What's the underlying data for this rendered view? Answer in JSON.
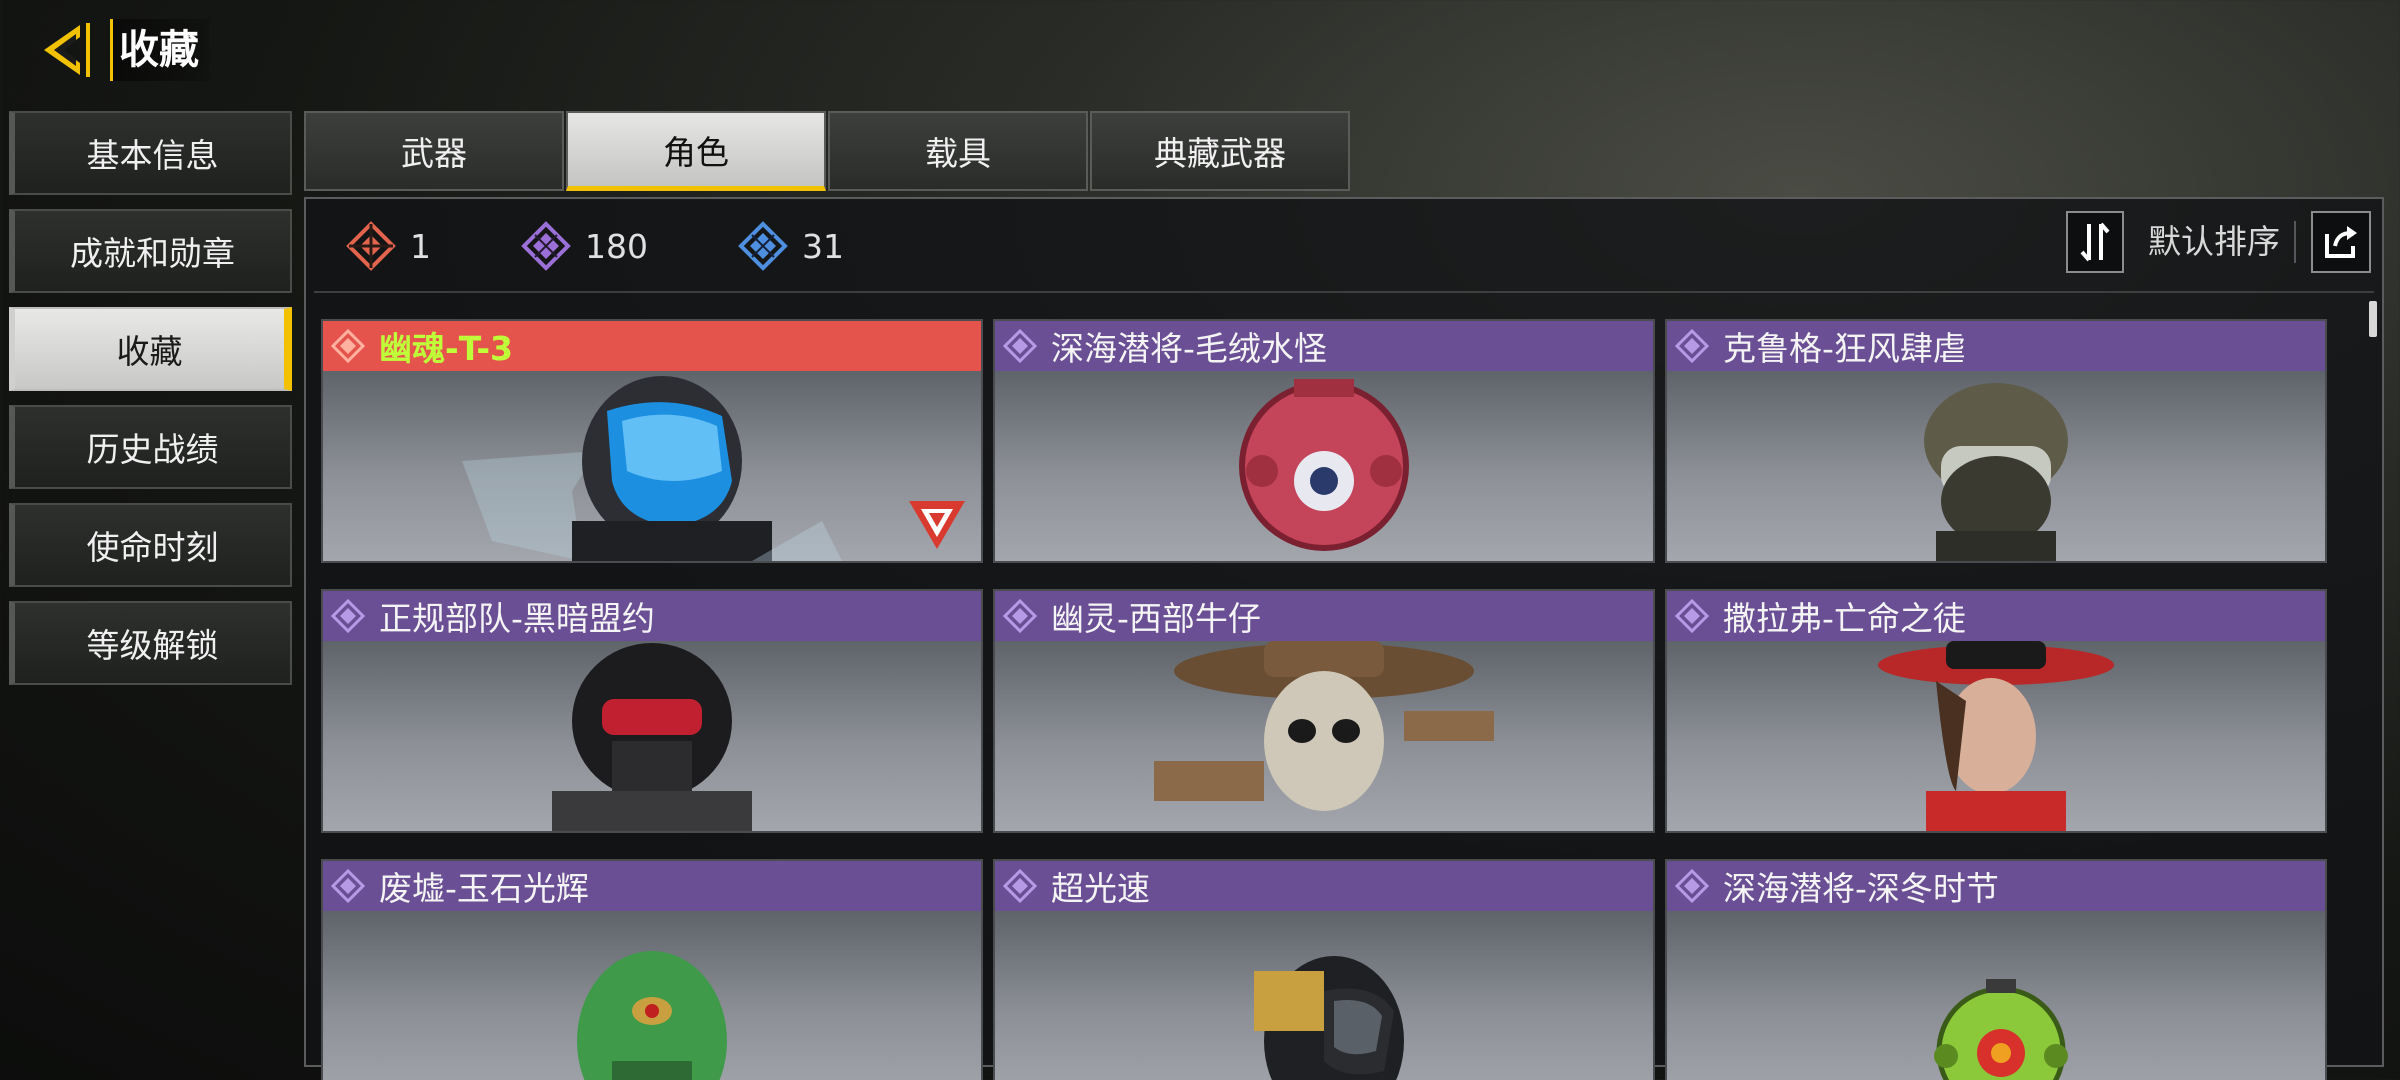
{
  "header": {
    "title": "收藏"
  },
  "sidebar": {
    "items": [
      {
        "label": "基本信息"
      },
      {
        "label": "成就和勋章"
      },
      {
        "label": "收藏"
      },
      {
        "label": "历史战绩"
      },
      {
        "label": "使命时刻"
      },
      {
        "label": "等级解锁"
      }
    ],
    "active_index": 2
  },
  "tabs": [
    {
      "label": "武器"
    },
    {
      "label": "角色"
    },
    {
      "label": "载具"
    },
    {
      "label": "典藏武器"
    }
  ],
  "active_tab": 1,
  "stats": {
    "legendary": {
      "icon": "legendary-rarity-icon",
      "color": "#e3644c",
      "count": "1"
    },
    "epic": {
      "icon": "epic-rarity-icon",
      "color": "#9b6fd8",
      "count": "180"
    },
    "rare": {
      "icon": "rare-rarity-icon",
      "color": "#4f8fe0",
      "count": "31"
    }
  },
  "sort": {
    "label": "默认排序",
    "sort_icon": "sort-toggle-icon",
    "share_icon": "share-icon"
  },
  "cards": [
    {
      "name": "幽魂-T-3",
      "rarity": "legendary",
      "accent": "#3fa9f5"
    },
    {
      "name": "深海潜将-毛绒水怪",
      "rarity": "epic",
      "accent": "#c4445a"
    },
    {
      "name": "克鲁格-狂风肆虐",
      "rarity": "epic",
      "accent": "#6b6a55"
    },
    {
      "name": "正规部队-黑暗盟约",
      "rarity": "epic",
      "accent": "#c02030"
    },
    {
      "name": "幽灵-西部牛仔",
      "rarity": "epic",
      "accent": "#8a6a48"
    },
    {
      "name": "撒拉弗-亡命之徒",
      "rarity": "epic",
      "accent": "#d03030"
    },
    {
      "name": "废墟-玉石光辉",
      "rarity": "epic",
      "accent": "#3f9a4a"
    },
    {
      "name": "超光速",
      "rarity": "epic",
      "accent": "#c8a040"
    },
    {
      "name": "深海潜将-深冬时节",
      "rarity": "epic",
      "accent": "#8bc83a"
    }
  ],
  "colors": {
    "accent_yellow": "#f2c200",
    "epic_header": "#6a4f94",
    "legendary_header": "#e5544c"
  }
}
